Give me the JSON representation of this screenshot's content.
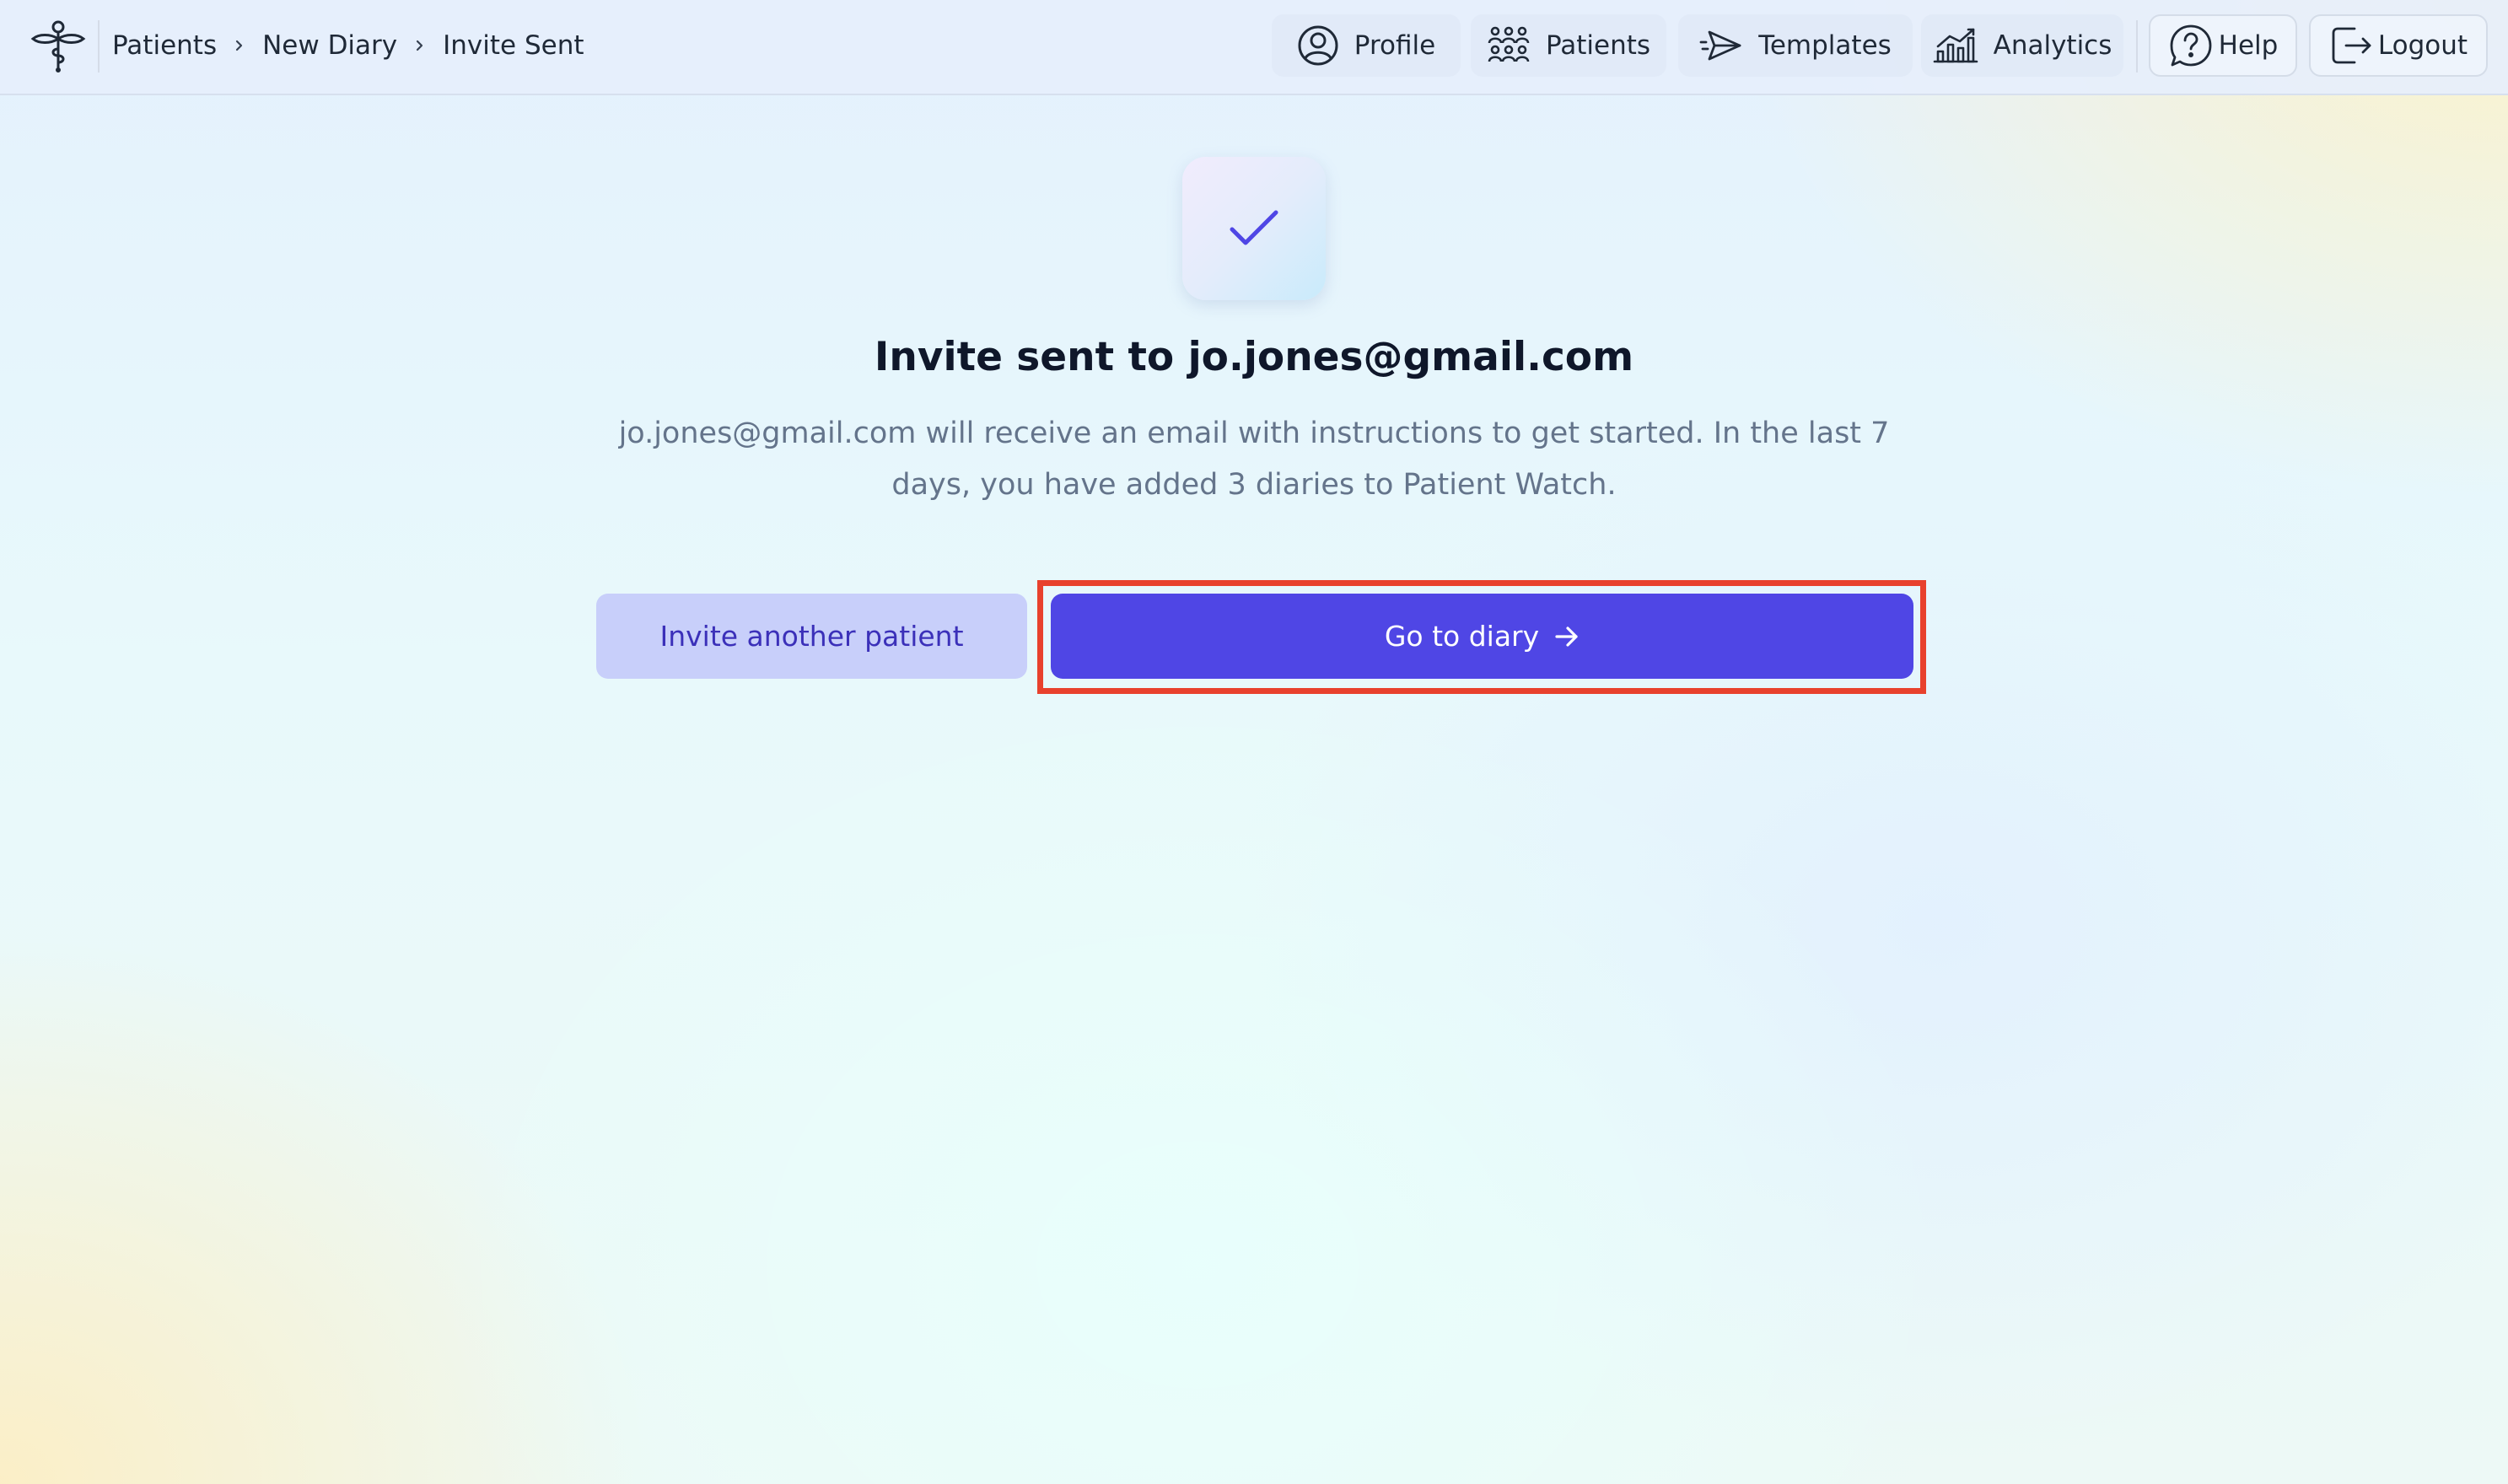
{
  "breadcrumb": {
    "items": [
      "Patients",
      "New Diary",
      "Invite Sent"
    ]
  },
  "nav": {
    "profile": "Profile",
    "patients": "Patients",
    "templates": "Templates",
    "analytics": "Analytics",
    "help": "Help",
    "logout": "Logout"
  },
  "icons": {
    "logo": "caduceus-logo-icon",
    "profile": "user-circle-icon",
    "patients": "people-group-icon",
    "templates": "paper-plane-icon",
    "analytics": "bar-chart-icon",
    "help": "question-bubble-icon",
    "logout": "logout-icon",
    "success": "check-icon",
    "arrow": "arrow-right-icon"
  },
  "main": {
    "title": "Invite sent to jo.jones@gmail.com",
    "description": "jo.jones@gmail.com will receive an email with instructions to get started. In the last 7 days, you have added 3 diaries to Patient Watch.",
    "secondary_button": "Invite another patient",
    "primary_button": "Go to diary"
  },
  "colors": {
    "primary": "#4f46e5",
    "secondary_bg": "#c8cffa",
    "secondary_text": "#3b30b9",
    "highlight": "#e8412d",
    "check": "#4f46e5"
  }
}
